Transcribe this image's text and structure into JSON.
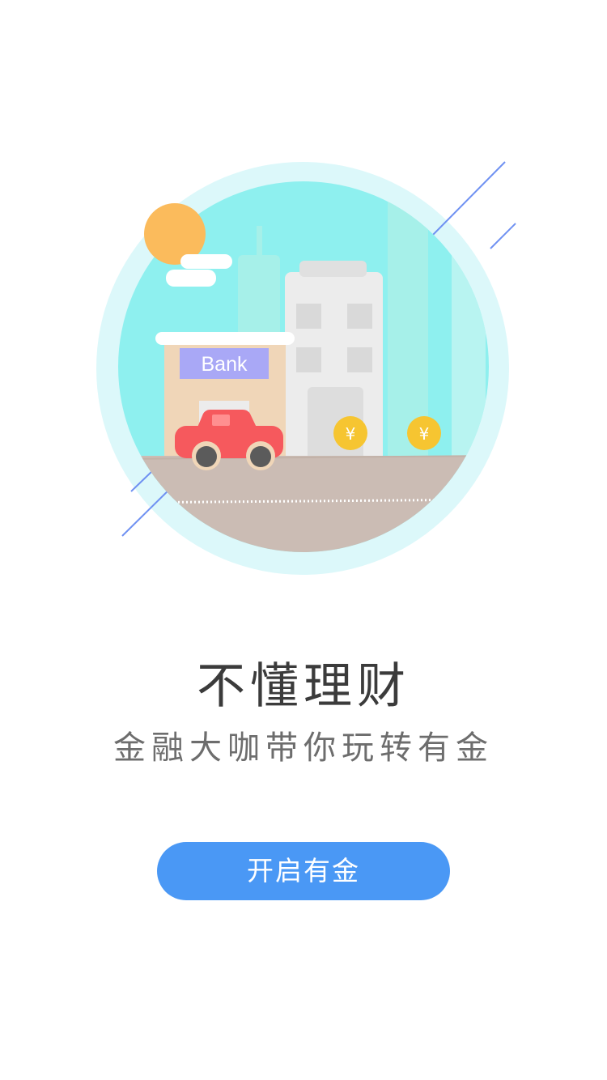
{
  "illustration": {
    "bank_sign": "Bank",
    "coin_symbol": "¥"
  },
  "onboarding": {
    "title": "不懂理财",
    "subtitle": "金融大咖带你玩转有金"
  },
  "cta": {
    "label": "开启有金"
  },
  "colors": {
    "accent": "#4a98f5",
    "sky": "#8ef0ef",
    "halo": "#dcf8fa",
    "sun": "#fbbb5c",
    "car": "#f6595d",
    "road": "#cbbcb4",
    "coin": "#f6c531",
    "bank_sign_bg": "#a9a8f6",
    "stripe": "#6f91f2"
  }
}
